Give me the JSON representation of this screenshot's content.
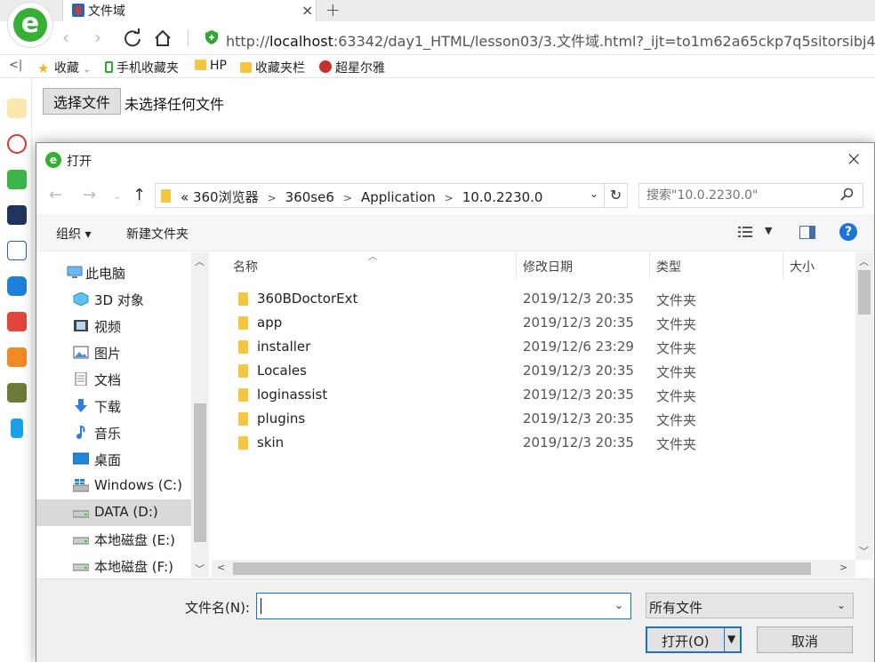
{
  "browser": {
    "tab_title": "文件域",
    "tab_close": "×",
    "new_tab": "+",
    "url_host": "localhost",
    "url_prefix": "http://",
    "url_rest": ":63342/day1_HTML/lesson03/3.文件域.html?_ijt=to1m62a65ckp7q5sitorsibj42",
    "fav_toggle": "<|",
    "favorites": [
      {
        "label": "收藏",
        "icon": "star-icon"
      },
      {
        "label": "手机收藏夹",
        "icon": "phone-icon"
      },
      {
        "label": "HP",
        "icon": "folder-icon"
      },
      {
        "label": "收藏夹栏",
        "icon": "folder-icon"
      },
      {
        "label": "超星尔雅",
        "icon": "chaoxing-icon"
      }
    ]
  },
  "page": {
    "file_button": "选择文件",
    "file_status": "未选择任何文件"
  },
  "dialog": {
    "title": "打开",
    "close": "×",
    "path": [
      "«",
      "360浏览器",
      "360se6",
      "Application",
      "10.0.2230.0"
    ],
    "search_placeholder": "搜索\"10.0.2230.0\"",
    "commands": {
      "organize": "组织 ▾",
      "new_folder": "新建文件夹"
    },
    "help": "?",
    "nav_items": [
      {
        "label": "此电脑",
        "icon": "computer-icon"
      },
      {
        "label": "3D 对象",
        "icon": "3d-objects-icon"
      },
      {
        "label": "视频",
        "icon": "video-icon"
      },
      {
        "label": "图片",
        "icon": "pictures-icon"
      },
      {
        "label": "文档",
        "icon": "documents-icon"
      },
      {
        "label": "下载",
        "icon": "download-icon"
      },
      {
        "label": "音乐",
        "icon": "music-icon"
      },
      {
        "label": "桌面",
        "icon": "desktop-icon"
      },
      {
        "label": "Windows (C:)",
        "icon": "windows-drive-icon"
      },
      {
        "label": "DATA (D:)",
        "icon": "drive-icon",
        "selected": true
      },
      {
        "label": "本地磁盘 (E:)",
        "icon": "drive-icon"
      },
      {
        "label": "本地磁盘 (F:)",
        "icon": "drive-icon"
      }
    ],
    "columns": {
      "name": "名称",
      "date": "修改日期",
      "type": "类型",
      "size": "大小"
    },
    "files": [
      {
        "name": "360BDoctorExt",
        "date": "2019/12/3 20:35",
        "type": "文件夹"
      },
      {
        "name": "app",
        "date": "2019/12/3 20:35",
        "type": "文件夹"
      },
      {
        "name": "installer",
        "date": "2019/12/6 23:29",
        "type": "文件夹"
      },
      {
        "name": "Locales",
        "date": "2019/12/3 20:35",
        "type": "文件夹"
      },
      {
        "name": "loginassist",
        "date": "2019/12/3 20:35",
        "type": "文件夹"
      },
      {
        "name": "plugins",
        "date": "2019/12/3 20:35",
        "type": "文件夹"
      },
      {
        "name": "skin",
        "date": "2019/12/3 20:35",
        "type": "文件夹"
      }
    ],
    "filename_label": "文件名(N):",
    "filename_value": "",
    "filetype": "所有文件",
    "open_button": "打开(O)",
    "cancel_button": "取消"
  },
  "colors": {
    "accent": "#1a73c8",
    "folder": "#f5c640",
    "brand_green": "#35b035"
  }
}
